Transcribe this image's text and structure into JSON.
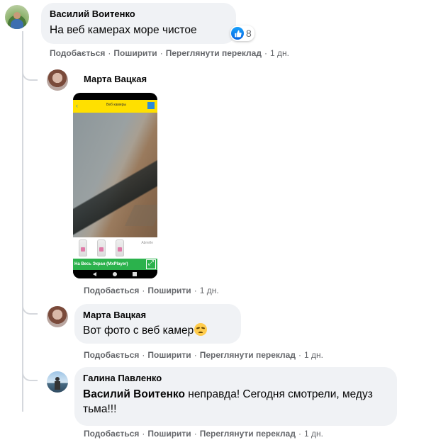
{
  "actions": {
    "like": "Подобається",
    "share": "Поширити",
    "see_translation": "Переглянути переклад",
    "separator": "·"
  },
  "comments": [
    {
      "author": "Василий Воитенко",
      "text": "На веб камерах море чистое",
      "reaction_count": "8",
      "time": "1 дн."
    },
    {
      "author": "Марта Вацкая",
      "time": "1 дн.",
      "attachment": {
        "app_title": "Веб камеры",
        "ad_brand": "Abrielle",
        "fullscreen_label": "На Весь Экран (MxPlayer)"
      }
    },
    {
      "author": "Марта Вацкая",
      "text": "Вот фото с веб камер",
      "time": "1 дн."
    },
    {
      "author": "Галина Павленко",
      "mention": "Василий Воитенко",
      "text": " неправда! Сегодня смотрели, медуз тьма!!!",
      "time": "1 дн."
    }
  ],
  "colors": {
    "bubble": "#f0f2f5",
    "action_text": "#65676b",
    "like_blue": "#0765e2",
    "thread_line": "#d5d8dd"
  }
}
